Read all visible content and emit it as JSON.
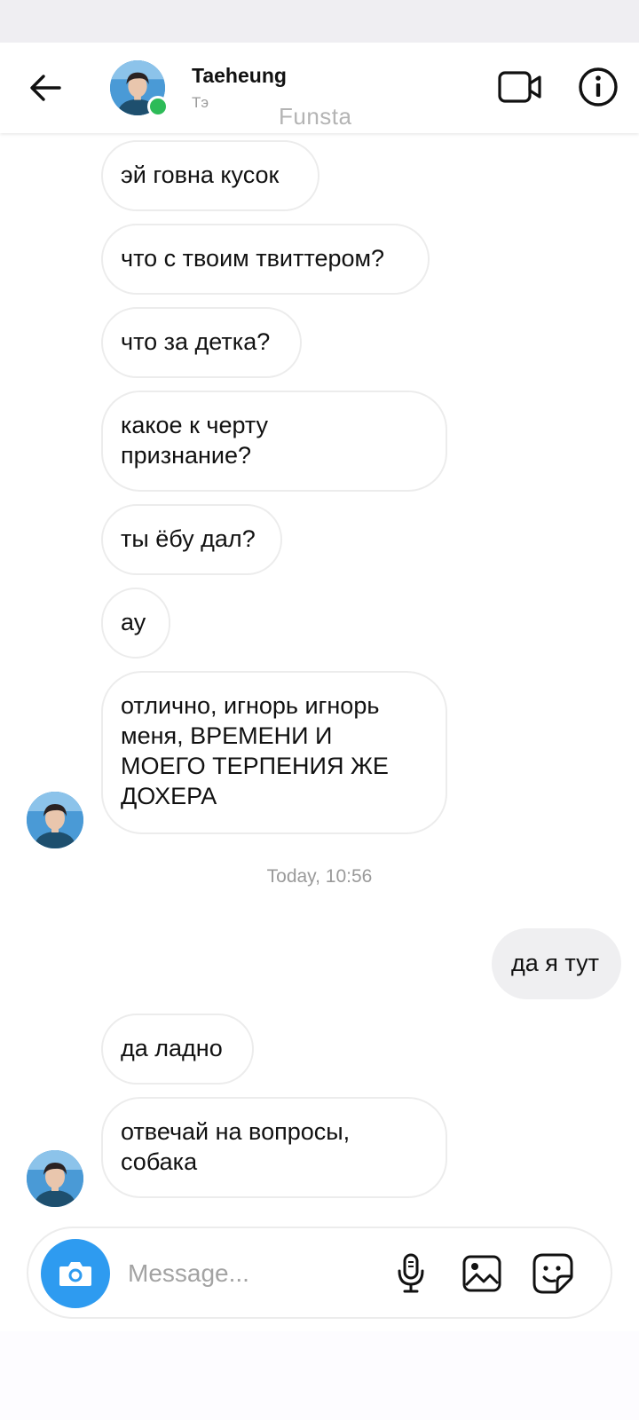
{
  "header": {
    "contact_name": "Taeheung",
    "contact_sub": "Тэ",
    "watermark": "Funsta",
    "online": true
  },
  "messages": [
    {
      "direction": "in",
      "text": "эй говна кусок"
    },
    {
      "direction": "in",
      "text": "что с твоим твиттером?"
    },
    {
      "direction": "in",
      "text": "что за детка?"
    },
    {
      "direction": "in",
      "lines": [
        "какое к черту",
        "признание?"
      ]
    },
    {
      "direction": "in",
      "text": "ты ёбу дал?"
    },
    {
      "direction": "in",
      "text": "ау"
    },
    {
      "direction": "in",
      "lines": [
        "отлично, игнорь игнорь",
        "меня, ВРЕМЕНИ И",
        "МОЕГО ТЕРПЕНИЯ ЖЕ",
        "ДОХЕРА"
      ]
    },
    {
      "direction": "out",
      "text": "да я тут"
    },
    {
      "direction": "in",
      "text": "да ладно"
    },
    {
      "direction": "in",
      "lines": [
        "отвечай на вопросы,",
        "собака"
      ]
    }
  ],
  "timestamp": "Today, 10:56",
  "composer": {
    "placeholder": "Message..."
  },
  "icons": {
    "back": "arrow-left-icon",
    "video": "video-camera-icon",
    "info": "info-icon",
    "camera": "camera-icon",
    "mic": "microphone-icon",
    "gallery": "image-icon",
    "sticker": "sticker-icon"
  },
  "colors": {
    "online": "#2dbb58",
    "camera_button": "#2e9bf0",
    "outgoing_bubble": "#efeff1",
    "incoming_border": "#ececec"
  }
}
